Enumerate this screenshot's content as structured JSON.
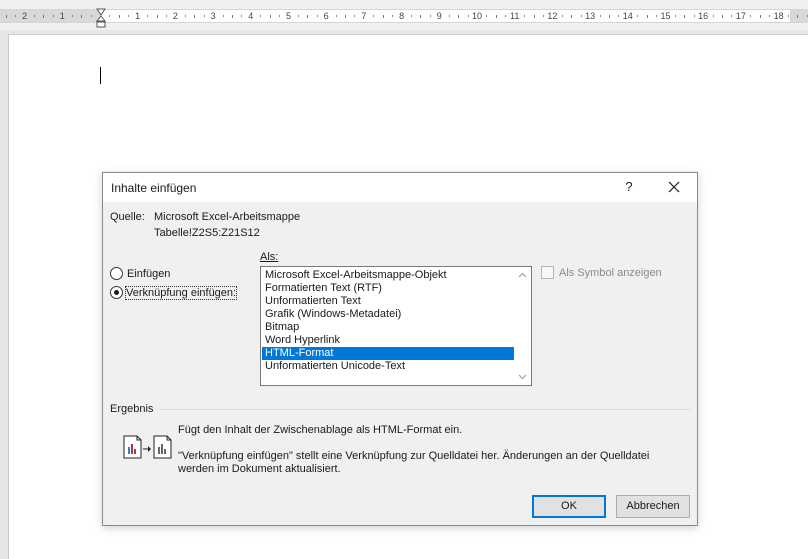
{
  "ruler": {
    "numbers": [
      "2",
      "1",
      "1",
      "2",
      "3",
      "4",
      "5",
      "6",
      "7",
      "8",
      "9",
      "10",
      "11",
      "12",
      "13",
      "14",
      "15",
      "16",
      "17",
      "18"
    ]
  },
  "dialog": {
    "title": "Inhalte einfügen",
    "help_symbol": "?",
    "source_label": "Quelle:",
    "source_line1": "Microsoft Excel-Arbeitsmappe",
    "source_line2": "Tabelle!Z2S5:Z21S12",
    "as_label": "Als:",
    "radio_paste": "Einfügen",
    "radio_paste_link": "Verknüpfung einfügen:",
    "selected_radio": "Verknüpfung einfügen:",
    "formats": [
      "Microsoft Excel-Arbeitsmappe-Objekt",
      "Formatierten Text (RTF)",
      "Unformatierten Text",
      "Grafik (Windows-Metadatei)",
      "Bitmap",
      "Word Hyperlink",
      "HTML-Format",
      "Unformatierten Unicode-Text"
    ],
    "selected_format": "HTML-Format",
    "display_as_icon": "Als Symbol anzeigen",
    "result_label": "Ergebnis",
    "result_line1": "Fügt den Inhalt der Zwischenablage als HTML-Format ein.",
    "result_line2": "\"Verknüpfung einfügen\" stellt eine Verknüpfung zur Quelldatei her. Änderungen an der Quelldatei",
    "result_line3": "werden im Dokument aktualisiert.",
    "ok_label": "OK",
    "cancel_label": "Abbrechen"
  },
  "colors": {
    "selection": "#0078d7",
    "dialog_bg": "#f0f0f0",
    "workspace_bg": "#e6e6e6"
  }
}
